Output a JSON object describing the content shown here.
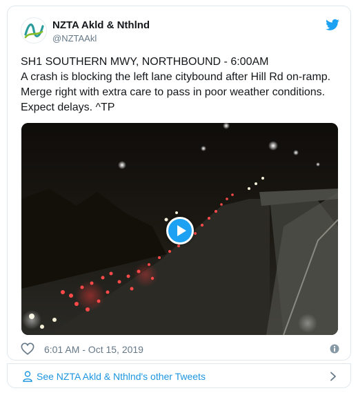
{
  "tweet": {
    "author_name": "NZTA Akld & Nthlnd",
    "author_handle": "@NZTAAkl",
    "text": "SH1 SOUTHERN MWY, NORTHBOUND - 6:00AM\nA crash is blocking the left lane citybound after Hill Rd on-ramp.\nMerge right with extra care to pass in poor weather conditions.\nExpect delays. ^TP",
    "timestamp": "6:01 AM - Oct 15, 2019"
  },
  "icons": {
    "avatar": "nzta-logo-icon",
    "brand": "twitter-bird-icon",
    "like": "heart-icon",
    "info": "info-icon",
    "profile": "person-icon",
    "more": "chevron-right-icon",
    "video": "play-icon"
  },
  "footer": {
    "link_label": "See NZTA Akld & Nthlnd's other Tweets"
  },
  "colors": {
    "accent": "#1da1f2",
    "link": "#1b95e0",
    "muted": "#657786",
    "border": "#e1e8ed"
  }
}
